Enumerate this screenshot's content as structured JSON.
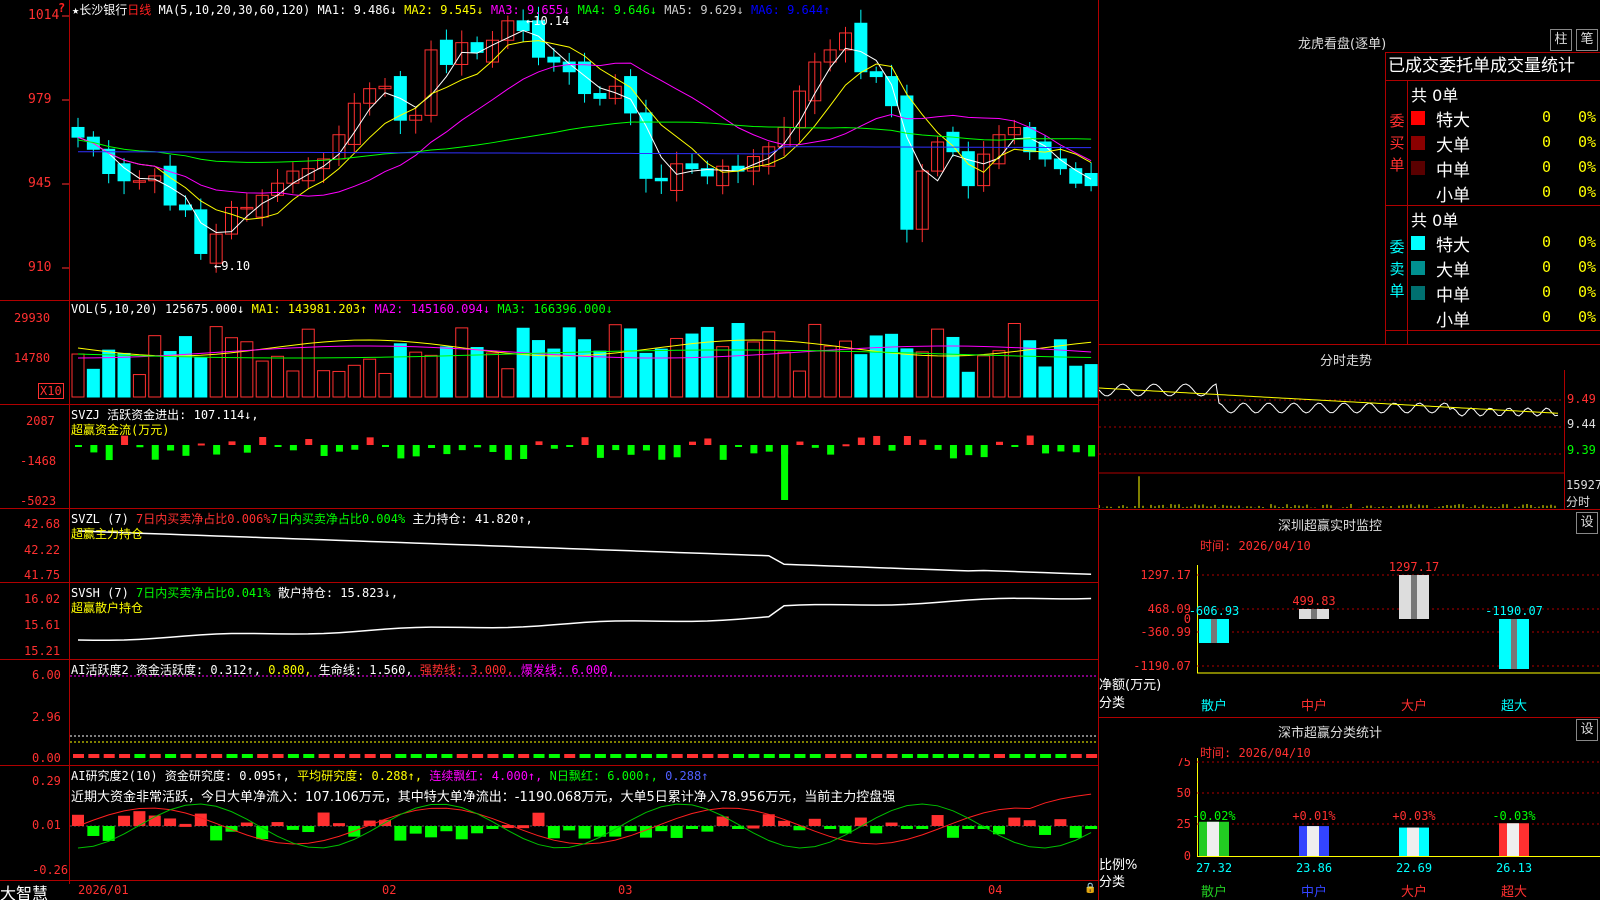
{
  "header": {
    "star": "★",
    "stock_name": "长沙银行",
    "period": "日线",
    "ma_params": "MA(5,10,20,30,60,120)",
    "ma_values": [
      {
        "label": "MA1:",
        "value": "9.486↓",
        "color": "#ffffff"
      },
      {
        "label": "MA2:",
        "value": "9.545↓",
        "color": "#ffff00"
      },
      {
        "label": "MA3:",
        "value": "9.655↓",
        "color": "#ff00ff"
      },
      {
        "label": "MA4:",
        "value": "9.646↓",
        "color": "#00ff00"
      },
      {
        "label": "MA5:",
        "value": "9.629↓",
        "color": "#cccccc"
      },
      {
        "label": "MA6:",
        "value": "9.644↑",
        "color": "#0000ff"
      }
    ]
  },
  "price_axis": [
    "1014",
    "979",
    "945",
    "910"
  ],
  "price_marks": {
    "high": "10.14",
    "low": "9.10"
  },
  "vol": {
    "title": "VOL(5,10,20)",
    "value": "125675.000↓",
    "ma1": "MA1: 143981.203↑",
    "ma2": "MA2: 145160.094↓",
    "ma3": "MA3: 166396.000↓",
    "axis": [
      "29930",
      "14780"
    ],
    "unit": "X10"
  },
  "svzj": {
    "title": "SVZJ",
    "desc": "活跃资金进出: 107.114↓,",
    "sub": "超赢资金流(万元)",
    "axis": [
      "2087",
      "-1468",
      "-5023"
    ]
  },
  "svzl": {
    "title": "SVZL (7)",
    "a": "7日内买卖净占比0.006%",
    "b": "7日内买卖净占比0.004%",
    "c": "主力持仓: 41.820↑,",
    "sub": "超赢主力持仓",
    "axis": [
      "42.68",
      "42.22",
      "41.75"
    ]
  },
  "svsh": {
    "title": "SVSH (7)",
    "a": "7日内买卖净占比0.041%",
    "c": "散户持仓: 15.823↓,",
    "sub": "超赢散户持仓",
    "axis": [
      "16.02",
      "15.61",
      "15.21"
    ]
  },
  "ai1": {
    "title": "AI活跃度2",
    "a": "资金活跃度: 0.312↑,",
    "b": "0.800,",
    "c": "生命线: 1.560,",
    "d": "强势线: 3.000,",
    "e": "爆发线: 6.000,",
    "axis": [
      "6.00",
      "2.96",
      "0.00"
    ]
  },
  "ai2": {
    "title": "AI研究度2(10)",
    "a": "资金研究度: 0.095↑,",
    "b": "平均研究度: 0.288↑,",
    "c": "连续飘红: 4.000↑,",
    "d": "N日飘红: 6.000↑,",
    "e": "0.288↑",
    "comment": "近期大资金非常活跃，今日大单净流入：107.106万元，其中特大单净流出：-1190.068万元，大单5日累计净入78.956万元，当前主力控盘强",
    "axis": [
      "0.29",
      "0.01",
      "-0.26"
    ]
  },
  "footer": {
    "brand": "大智慧",
    "dates": [
      "2026/01",
      "02",
      "03",
      "04"
    ]
  },
  "lhb": {
    "title": "龙虎看盘(逐单)",
    "btn1": "柱",
    "btn2": "笔",
    "header": "已成交委托单成交量统计",
    "buy_label": "委买单",
    "buy_total": "共 0单",
    "buy_rows": [
      {
        "label": "特大",
        "color": "#ff0000",
        "count": "0",
        "pct": "0%"
      },
      {
        "label": "大单",
        "color": "#8b0000",
        "count": "0",
        "pct": "0%"
      },
      {
        "label": "中单",
        "color": "#5a0000",
        "count": "0",
        "pct": "0%"
      },
      {
        "label": "小单",
        "color": "",
        "count": "0",
        "pct": "0%"
      }
    ],
    "sell_label": "委卖单",
    "sell_total": "共 0单",
    "sell_rows": [
      {
        "label": "特大",
        "color": "#00ffff",
        "count": "0",
        "pct": "0%"
      },
      {
        "label": "大单",
        "color": "#009090",
        "count": "0",
        "pct": "0%"
      },
      {
        "label": "中单",
        "color": "#007070",
        "count": "0",
        "pct": "0%"
      },
      {
        "label": "小单",
        "color": "",
        "count": "0",
        "pct": "0%"
      }
    ]
  },
  "intraday": {
    "title": "分时走势",
    "axis": [
      "9.49",
      "9.44",
      "9.39"
    ],
    "vol_axis": "15927",
    "vol_unit": "分时"
  },
  "monitor": {
    "title": "深圳超赢实时监控",
    "btn": "设",
    "time": "时间: 2026/04/10",
    "axis": [
      "1297.17",
      "468.09",
      "0",
      "-360.99",
      "-1190.07"
    ],
    "axis_name": "净额(万元)",
    "cat_name": "分类",
    "categories": [
      "散户",
      "中户",
      "大户",
      "超大"
    ],
    "values": [
      "-606.93",
      "499.83",
      "1297.17",
      "-1190.07"
    ]
  },
  "classify": {
    "title": "深市超赢分类统计",
    "btn": "设",
    "time": "时间: 2026/04/10",
    "axis": [
      "75",
      "50",
      "25",
      "0"
    ],
    "axis_name": "比例%",
    "cat_name": "分类",
    "categories": [
      "散户",
      "中户",
      "大户",
      "超大"
    ],
    "changes": [
      "-0.02%",
      "+0.01%",
      "+0.03%",
      "-0.03%"
    ],
    "values": [
      "27.32",
      "23.86",
      "22.69",
      "26.13"
    ]
  }
}
